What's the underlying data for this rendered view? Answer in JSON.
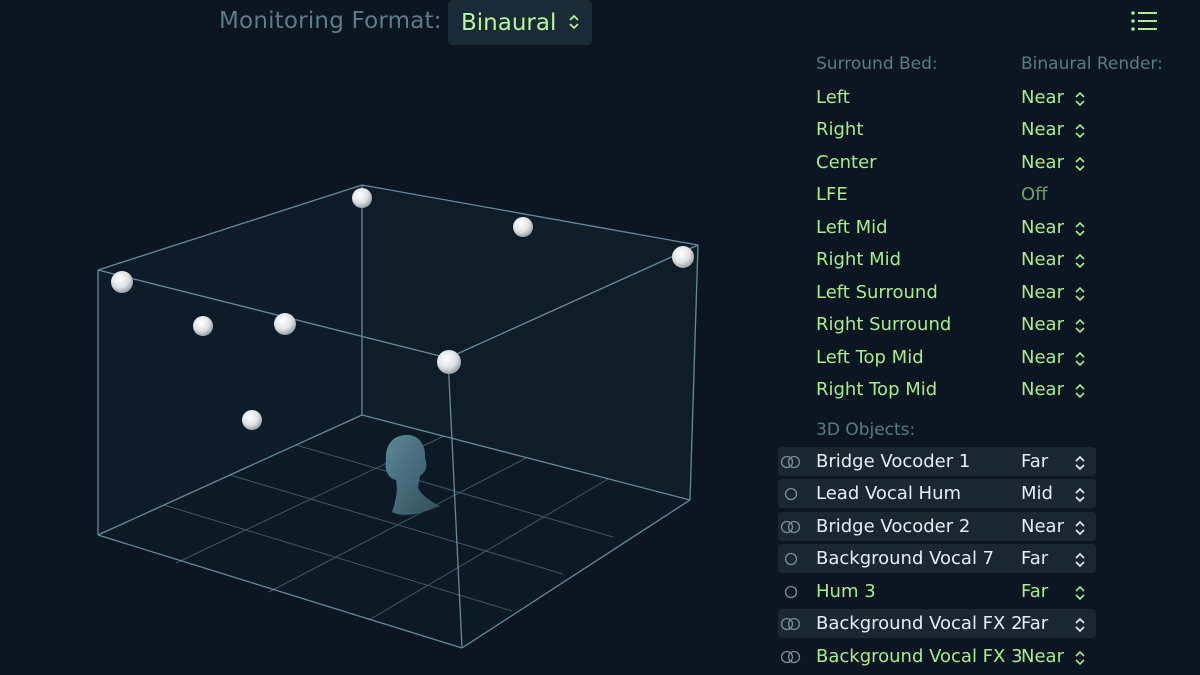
{
  "header": {
    "format_label": "Monitoring Format:",
    "format_value": "Binaural"
  },
  "colors": {
    "background": "#0b1622",
    "accent_green": "#a8ec8c",
    "header_text": "#5c7a86",
    "box_line": "#7fa3b8"
  },
  "icons": {
    "menu": "list-icon",
    "select": "up-down-chevron-icon",
    "link": "link-circles-icon"
  },
  "surround_bed": {
    "header": "Surround Bed:",
    "render_header": "Binaural Render:",
    "items": [
      {
        "name": "Left",
        "mode": "Near"
      },
      {
        "name": "Right",
        "mode": "Near"
      },
      {
        "name": "Center",
        "mode": "Near"
      },
      {
        "name": "LFE",
        "mode": "Off"
      },
      {
        "name": "Left Mid",
        "mode": "Near"
      },
      {
        "name": "Right Mid",
        "mode": "Near"
      },
      {
        "name": "Left Surround",
        "mode": "Near"
      },
      {
        "name": "Right Surround",
        "mode": "Near"
      },
      {
        "name": "Left Top Mid",
        "mode": "Near"
      },
      {
        "name": "Right Top Mid",
        "mode": "Near"
      }
    ]
  },
  "objects": {
    "header": "3D Objects:",
    "items": [
      {
        "name": "Bridge Vocoder 1",
        "mode": "Far",
        "linked": true
      },
      {
        "name": "Lead Vocal Hum",
        "mode": "Mid",
        "linked": false
      },
      {
        "name": "Bridge Vocoder 2",
        "mode": "Near",
        "linked": true
      },
      {
        "name": "Background Vocal 7",
        "mode": "Far",
        "linked": false
      },
      {
        "name": "Hum 3",
        "mode": "Far",
        "linked": false
      },
      {
        "name": "Background Vocal FX 2",
        "mode": "Far",
        "linked": true
      },
      {
        "name": "Background Vocal FX 3",
        "mode": "Near",
        "linked": true
      }
    ]
  }
}
